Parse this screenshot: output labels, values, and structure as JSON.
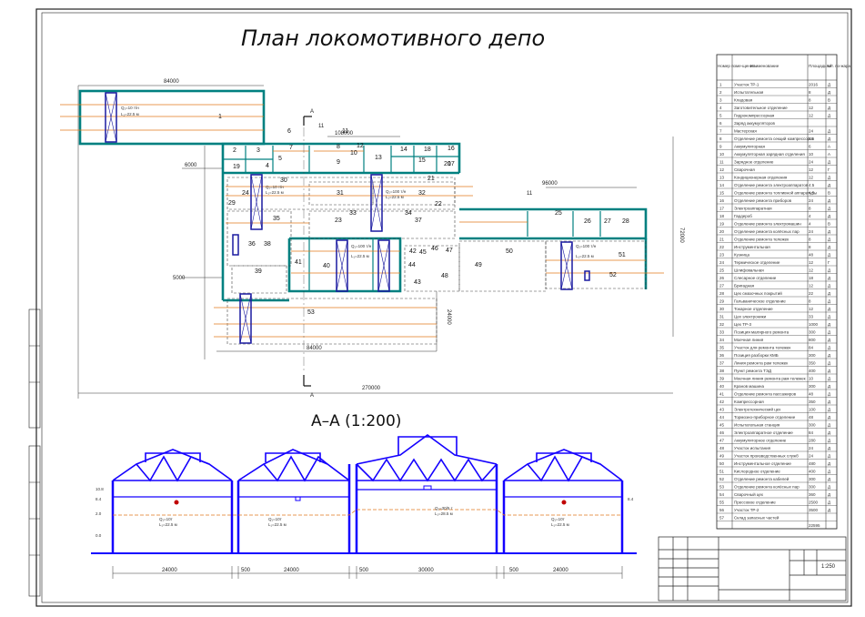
{
  "title": "План локомотивного депо",
  "section_title": "А–А (1:200)",
  "scale_label": "1:250",
  "section_marks": [
    "А",
    "А"
  ],
  "colors": {
    "wall": "#008080",
    "dim": "#333333",
    "track": "#e07a1c",
    "crane": "#1a1aa0",
    "truss": "#1400ff",
    "note": "#c00000"
  },
  "dims": {
    "top_left": "84000",
    "top_mid": "108000",
    "right_block": "96000",
    "left_6000": "6000",
    "left_5000": "5000",
    "bottom_84000": "84000",
    "overall": "270000",
    "right_vert": "72000",
    "inner_vert": "24000",
    "sec_24000_a": "24000",
    "sec_500_a": "500",
    "sec_24000_b": "24000",
    "sec_500_b": "500",
    "sec_30000": "30000",
    "sec_500_c": "500",
    "sec_24000_c": "24000",
    "gap_11": "11"
  },
  "crane_plan_1": [
    "Q₁=10 т/н",
    "L₁=22.5 м"
  ],
  "crane_plan_2": [
    "Q₁=10 т/н",
    "L₁=22.5 м"
  ],
  "crane_plan_3": [
    "Q₁=100 т/н",
    "L₁=22.5 м"
  ],
  "crane_plan_4": [
    "Q₁=100 т/н",
    "L₁=22.5 м"
  ],
  "crane_plan_5": [
    "Q₁=100 т/н",
    "L₁=22.5 м"
  ],
  "crane_sec_1": [
    "Q₁=10т",
    "L₁=22.5 м"
  ],
  "crane_sec_2": [
    "Q₁=10т",
    "L₁=22.5 м"
  ],
  "crane_sec_3": [
    "Q₁=30/5 т",
    "L₁=28.5 м"
  ],
  "crane_sec_4": [
    "Q₁=10т",
    "L₁=22.5 м"
  ],
  "rooms": [
    "1",
    "2",
    "3",
    "4",
    "5",
    "6",
    "7",
    "8",
    "9",
    "10",
    "11",
    "12",
    "13",
    "14",
    "15",
    "16",
    "17",
    "18",
    "19",
    "20",
    "21",
    "22",
    "23",
    "24",
    "25",
    "26",
    "27",
    "28",
    "29",
    "30",
    "31",
    "32",
    "33",
    "34",
    "35",
    "36",
    "37",
    "38",
    "39",
    "40",
    "41",
    "42",
    "43",
    "44",
    "45",
    "46",
    "47",
    "48",
    "49",
    "50",
    "51",
    "52",
    "53"
  ],
  "levels": [
    "10.8",
    "8.4",
    "8.4",
    "2.0",
    "0.0"
  ],
  "table": {
    "headers": [
      "Номер поме-щения",
      "Наименование",
      "Площадь м²",
      "Кат. по-жара"
    ],
    "rows": [
      [
        "1",
        "Участок ТР-1",
        "2016",
        "Д"
      ],
      [
        "2",
        "Испытательная",
        "8",
        "Д"
      ],
      [
        "3",
        "Кладовая",
        "8",
        "В"
      ],
      [
        "4",
        "Заготовительное отделение",
        "12",
        "Д"
      ],
      [
        "5",
        "Гидрокомпрессорная",
        "12",
        "Д"
      ],
      [
        "6",
        "Заряд аккумуляторов",
        "",
        ""
      ],
      [
        "7",
        "Мастерская",
        "24",
        "Д"
      ],
      [
        "8",
        "Отделение ремонта секций компрессоров",
        "84",
        "Д"
      ],
      [
        "9",
        "Аккумуляторная",
        "6",
        "А"
      ],
      [
        "10",
        "Аккумуляторная зарядная отделения",
        "10",
        "А"
      ],
      [
        "11",
        "Зарядное отделение",
        "24",
        "Д"
      ],
      [
        "12",
        "Сварочная",
        "12",
        "Г"
      ],
      [
        "13",
        "Кондиционерная отделения",
        "12",
        "Д"
      ],
      [
        "14",
        "Отделение ремонта электроаппаратов",
        "4.5",
        "Д"
      ],
      [
        "15",
        "Отделение ремонта топливной аппаратуры",
        "4.5",
        "В"
      ],
      [
        "16",
        "Отделение ремонта приборов",
        "24",
        "Д"
      ],
      [
        "17",
        "Электроаппаратная",
        "8",
        "Д"
      ],
      [
        "18",
        "Гардероб",
        "4",
        "Д"
      ],
      [
        "19",
        "Отделение ремонта электромашин",
        "4",
        "В"
      ],
      [
        "20",
        "Отделение ремонта колёсных пар",
        "24",
        "Д"
      ],
      [
        "21",
        "Отделение ремонта тележек",
        "8",
        "Д"
      ],
      [
        "22",
        "Инструментальная",
        "8",
        "Д"
      ],
      [
        "23",
        "Кузница",
        "48",
        "Д"
      ],
      [
        "24",
        "Термическое отделение",
        "12",
        "Г"
      ],
      [
        "25",
        "Шлифовальная",
        "12",
        "Д"
      ],
      [
        "26",
        "Слесарное отделение",
        "18",
        "Д"
      ],
      [
        "27",
        "Бригадная",
        "12",
        "Д"
      ],
      [
        "28",
        "Цех смазочных покрытий",
        "22",
        "Д"
      ],
      [
        "29",
        "Гальваническое отделение",
        "8",
        "Д"
      ],
      [
        "30",
        "Токарное отделение",
        "12",
        "Д"
      ],
      [
        "31",
        "Цех электроники",
        "33",
        "Д"
      ],
      [
        "32",
        "Цех ТР-3",
        "1000",
        "Д"
      ],
      [
        "33",
        "Позиция малярного ремонта",
        "300",
        "Д"
      ],
      [
        "34",
        "Моечная линия",
        "800",
        "Д"
      ],
      [
        "35",
        "Участок для ремонта тележек",
        "84",
        "Д"
      ],
      [
        "36",
        "Позиция разборки КМБ",
        "300",
        "Д"
      ],
      [
        "37",
        "Линия ремонта рам тележек",
        "350",
        "Д"
      ],
      [
        "38",
        "Пункт ремонта ТЭД",
        "400",
        "Д"
      ],
      [
        "39",
        "Моечная линия ремонта рам тележек",
        "10",
        "Д"
      ],
      [
        "40",
        "Кранов машина",
        "300",
        "Д"
      ],
      [
        "41",
        "Отделение ремонта пассажиров",
        "48",
        "Д"
      ],
      [
        "42",
        "Компрессорная",
        "350",
        "Д"
      ],
      [
        "43",
        "Электротехнический цех",
        "100",
        "Д"
      ],
      [
        "44",
        "Тормозно-приборное отделение",
        "48",
        "Д"
      ],
      [
        "45",
        "Испытательная станция",
        "300",
        "Д"
      ],
      [
        "46",
        "Электроаппаратное отделение",
        "84",
        "Д"
      ],
      [
        "47",
        "Аккумуляторное отделение",
        "280",
        "Д"
      ],
      [
        "48",
        "Участок испытания",
        "24",
        "Д"
      ],
      [
        "49",
        "Участок производственных служб",
        "24",
        "Д"
      ],
      [
        "50",
        "Инструментальное отделение",
        "480",
        "Д"
      ],
      [
        "51",
        "Кислородное отделение",
        "400",
        "Д"
      ],
      [
        "52",
        "Отделение ремонта кабелей",
        "300",
        "Д"
      ],
      [
        "53",
        "Отделение ремонта колёсных пар",
        "300",
        "Д"
      ],
      [
        "54",
        "Сварочный цех",
        "360",
        "Д"
      ],
      [
        "55",
        "Прессовое отделение",
        "2500",
        "Д"
      ],
      [
        "56",
        "Участок ТР-2",
        "3500",
        "Д"
      ],
      [
        "57",
        "Склад запасных частей",
        "",
        ""
      ],
      [
        "",
        "",
        "22595",
        ""
      ]
    ]
  }
}
